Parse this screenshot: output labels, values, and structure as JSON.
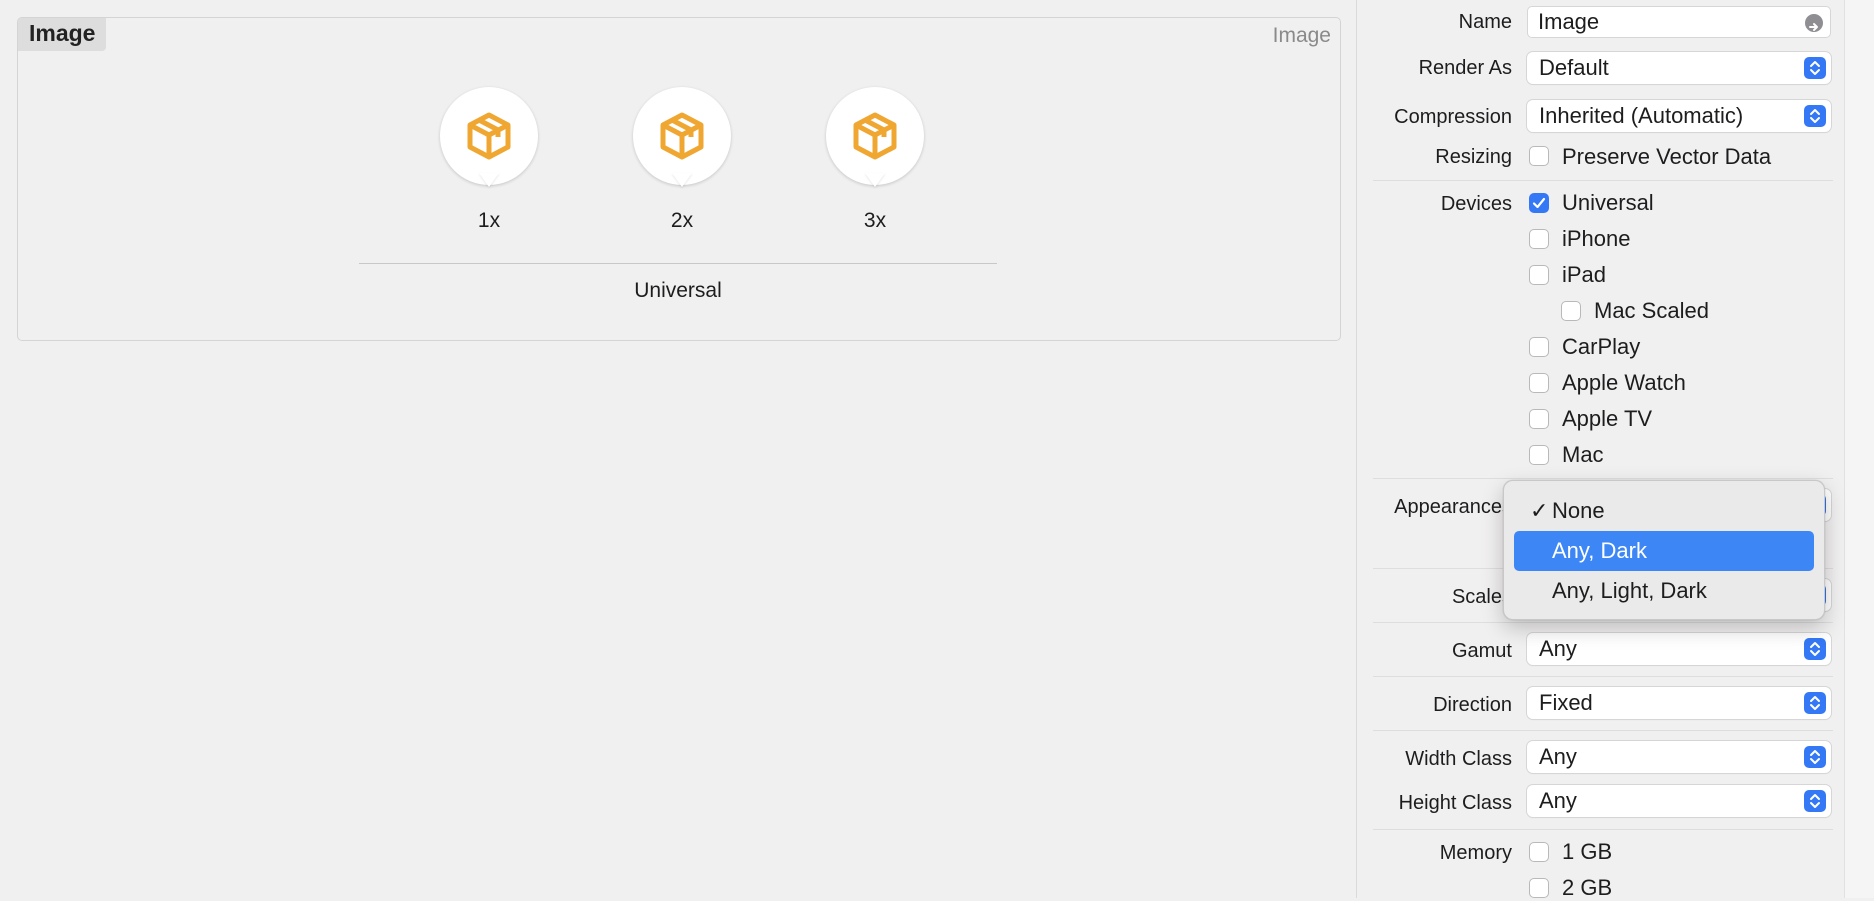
{
  "canvas": {
    "set_name": "Image",
    "set_type": "Image",
    "slots": [
      {
        "label": "1x",
        "icon": "package-cube-icon"
      },
      {
        "label": "2x",
        "icon": "package-cube-icon"
      },
      {
        "label": "3x",
        "icon": "package-cube-icon"
      }
    ],
    "group_label": "Universal",
    "icon_color": "#f0a732"
  },
  "inspector": {
    "name": {
      "label": "Name",
      "value": "Image"
    },
    "render_as": {
      "label": "Render As",
      "value": "Default"
    },
    "compression": {
      "label": "Compression",
      "value": "Inherited (Automatic)"
    },
    "resizing": {
      "label": "Resizing",
      "option": "Preserve Vector Data",
      "checked": false
    },
    "devices": {
      "label": "Devices",
      "items": [
        {
          "label": "Universal",
          "checked": true
        },
        {
          "label": "iPhone",
          "checked": false
        },
        {
          "label": "iPad",
          "checked": false
        },
        {
          "label": "Mac Scaled",
          "checked": false
        },
        {
          "label": "CarPlay",
          "checked": false
        },
        {
          "label": "Apple Watch",
          "checked": false
        },
        {
          "label": "Apple TV",
          "checked": false
        },
        {
          "label": "Mac",
          "checked": false
        }
      ]
    },
    "appearances": {
      "label": "Appearances"
    },
    "scales": {
      "label": "Scales"
    },
    "gamut": {
      "label": "Gamut",
      "value": "Any"
    },
    "direction": {
      "label": "Direction",
      "value": "Fixed"
    },
    "width_class": {
      "label": "Width Class",
      "value": "Any"
    },
    "height_class": {
      "label": "Height Class",
      "value": "Any"
    },
    "memory": {
      "label": "Memory",
      "items": [
        {
          "label": "1 GB",
          "checked": false
        },
        {
          "label": "2 GB",
          "checked": false
        }
      ]
    }
  },
  "appearance_menu": {
    "items": [
      {
        "label": "None",
        "selected": true,
        "highlighted": false
      },
      {
        "label": "Any, Dark",
        "selected": false,
        "highlighted": true
      },
      {
        "label": "Any, Light, Dark",
        "selected": false,
        "highlighted": false
      }
    ]
  },
  "colors": {
    "accent": "#3478f6",
    "menu_highlight": "#3d86f5",
    "icon": "#f0a732"
  }
}
